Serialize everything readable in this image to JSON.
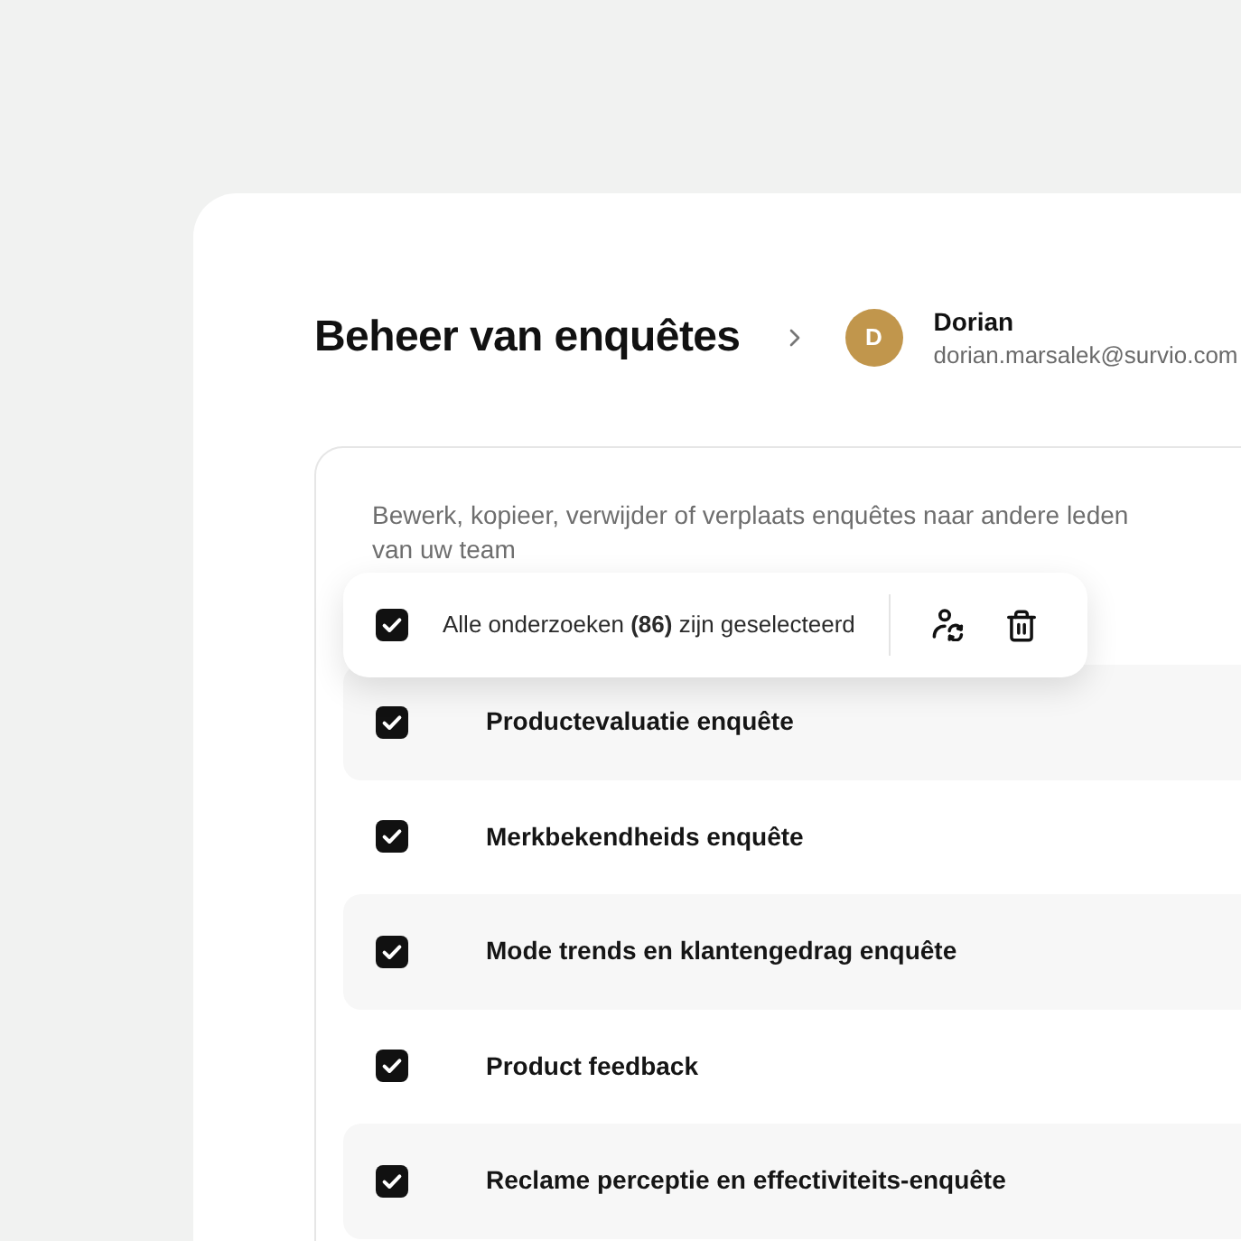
{
  "page": {
    "title": "Beheer van enquêtes"
  },
  "user": {
    "initial": "D",
    "name": "Dorian",
    "email": "dorian.marsalek@survio.com"
  },
  "panel": {
    "description": "Bewerk, kopieer, verwijder of verplaats enquêtes naar andere leden van uw team"
  },
  "selection_bar": {
    "checked": true,
    "label": "Alle onderzoeken **(86)** zijn geselecteerd"
  },
  "surveys": [
    {
      "title": "Productevaluatie enquête",
      "checked": true
    },
    {
      "title": "Merkbekendheids enquête",
      "checked": true
    },
    {
      "title": "Mode trends en klantengedrag enquête",
      "checked": true
    },
    {
      "title": "Product feedback",
      "checked": true
    },
    {
      "title": "Reclame perceptie en effectiviteits-enquête",
      "checked": true
    }
  ]
}
